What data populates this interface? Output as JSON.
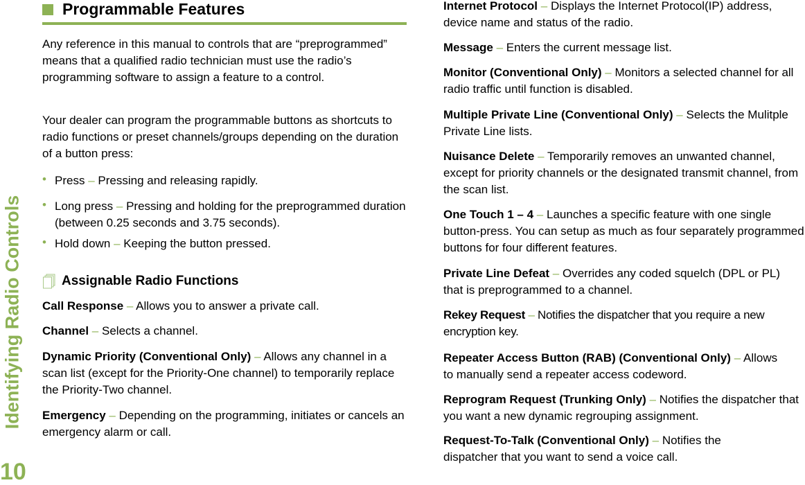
{
  "sidebar": {
    "chapter_title": "Identifying Radio Controls",
    "page_number": "10",
    "accent_color": "#8db255"
  },
  "section": {
    "title": "Programmable Features",
    "intro_paragraphs": [
      "Any reference in this manual to controls that are “preprogrammed” means that a qualified radio technician must use the radio’s programming software to assign a feature to a control.",
      "Your dealer can program the programmable buttons as shortcuts to radio functions or preset channels/groups depending on the duration of a button press:"
    ],
    "bullets": [
      {
        "term": "Press",
        "desc": "Pressing and releasing rapidly."
      },
      {
        "term": "Long press",
        "desc": "Pressing and holding for the preprogrammed duration (between 0.25 seconds and 3.75 seconds)."
      },
      {
        "term": "Hold down",
        "desc": "Keeping the button pressed."
      }
    ]
  },
  "subsection": {
    "title": "Assignable Radio Functions",
    "icon": "pages-icon"
  },
  "dash": "–",
  "left_entries": [
    {
      "term": "Call Response",
      "desc": "Allows you to answer a private call."
    },
    {
      "term": "Channel",
      "desc": "Selects a channel."
    },
    {
      "term": "Dynamic Priority (Conventional Only)",
      "desc": "Allows any channel in a scan list (except for the Priority-One channel) to temporarily replace the Priority-Two channel."
    },
    {
      "term": "Emergency",
      "desc": "Depending on the programming, initiates or cancels an emergency alarm or call."
    }
  ],
  "right_entries": [
    {
      "term": "Internet Protocol",
      "desc": "Displays the Internet Protocol(IP) address, device name and status of the radio."
    },
    {
      "term": "Message",
      "desc": "Enters the current message list."
    },
    {
      "term": "Monitor (Conventional Only)",
      "desc": "Monitors a selected channel for all radio traffic until function is disabled."
    },
    {
      "term": "Multiple Private Line (Conventional Only)",
      "desc": "Selects the Mulitple Private Line lists."
    },
    {
      "term": "Nuisance Delete",
      "desc": "Temporarily removes an unwanted channel, except for priority channels or the designated transmit channel, from the scan list."
    },
    {
      "term": "One Touch 1 – 4",
      "desc": "Launches a specific feature with one single button-press. You can setup as much as four separately programmed buttons for four different features."
    },
    {
      "term": "Private Line Defeat",
      "desc": "Overrides any coded squelch (DPL or PL) that is preprogrammed to a channel."
    },
    {
      "term": "Rekey Request",
      "desc": "Notifies the dispatcher that you require a new encryption key."
    },
    {
      "term": "Repeater Access Button (RAB) (Conventional Only)",
      "desc": "Allows to manually send a repeater access codeword."
    },
    {
      "term": "Reprogram Request (Trunking Only)",
      "desc": "Notifies the dispatcher that you want a new dynamic regrouping assignment."
    },
    {
      "term": "Request-To-Talk (Conventional Only)",
      "desc": "Notifies the dispatcher that you want to send a voice call."
    }
  ]
}
